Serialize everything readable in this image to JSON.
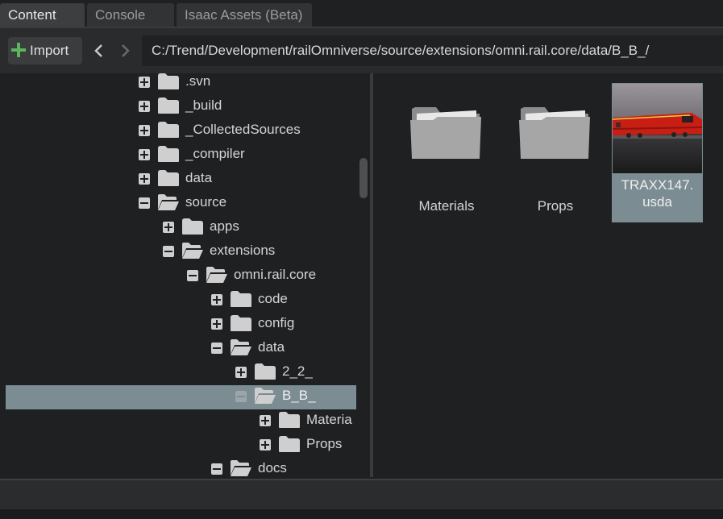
{
  "tabs": [
    {
      "label": "Content",
      "active": true
    },
    {
      "label": "Console",
      "active": false
    },
    {
      "label": "Isaac Assets (Beta)",
      "active": false
    }
  ],
  "toolbar": {
    "import_label": "Import",
    "path": "C:/Trend/Development/railOmniverse/source/extensions/omni.rail.core/data/B_B_/"
  },
  "tree": [
    {
      "label": ".svn",
      "depth": 0,
      "expanded": false
    },
    {
      "label": "_build",
      "depth": 0,
      "expanded": false
    },
    {
      "label": "_CollectedSources",
      "depth": 0,
      "expanded": false
    },
    {
      "label": "_compiler",
      "depth": 0,
      "expanded": false
    },
    {
      "label": "data",
      "depth": 0,
      "expanded": false
    },
    {
      "label": "source",
      "depth": 0,
      "expanded": true
    },
    {
      "label": "apps",
      "depth": 1,
      "expanded": false
    },
    {
      "label": "extensions",
      "depth": 1,
      "expanded": true
    },
    {
      "label": "omni.rail.core",
      "depth": 2,
      "expanded": true
    },
    {
      "label": "code",
      "depth": 3,
      "expanded": false
    },
    {
      "label": "config",
      "depth": 3,
      "expanded": false
    },
    {
      "label": "data",
      "depth": 3,
      "expanded": true
    },
    {
      "label": "2_2_",
      "depth": 4,
      "expanded": false
    },
    {
      "label": "B_B_",
      "depth": 4,
      "expanded": true,
      "selected": true
    },
    {
      "label": "Materia",
      "depth": 5,
      "expanded": false
    },
    {
      "label": "Props",
      "depth": 5,
      "expanded": false
    },
    {
      "label": "docs",
      "depth": 3,
      "expanded": true
    }
  ],
  "grid": {
    "items": [
      {
        "label": "Materials",
        "type": "folder"
      },
      {
        "label": "Props",
        "type": "folder"
      },
      {
        "label_line1": "TRAXX147.",
        "label_line2": "usda",
        "type": "usd-file",
        "selected": true
      }
    ]
  },
  "colors": {
    "selection": "#7b8d93",
    "accent_green": "#5eb35e",
    "background": "#1f2022"
  },
  "icons": {
    "import": "plus-icon",
    "back": "chevron-left-icon",
    "forward": "chevron-right-icon",
    "folder_closed": "folder-icon",
    "folder_open": "folder-open-icon",
    "expand": "plus-box-icon",
    "collapse": "minus-box-icon"
  }
}
